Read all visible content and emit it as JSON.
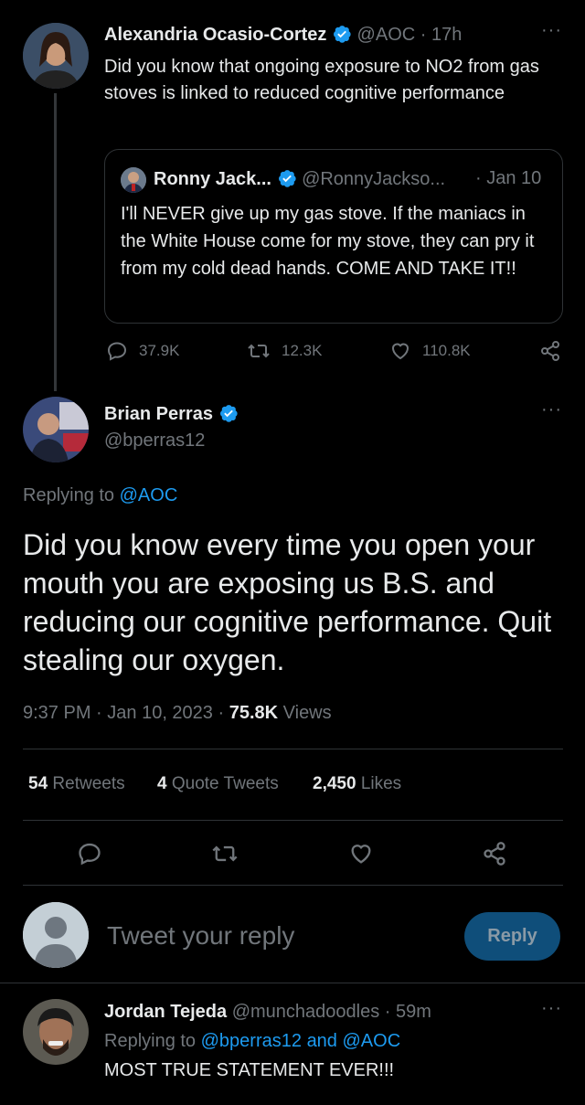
{
  "tweet1": {
    "name": "Alexandria Ocasio-Cortez",
    "handle": "@AOC",
    "time": "17h",
    "text": "Did you know that ongoing exposure to NO2 from gas stoves is linked to reduced cognitive performance",
    "quote": {
      "name": "Ronny Jack...",
      "handle": "@RonnyJackso...",
      "time": "Jan 10",
      "text": "I'll NEVER give up my gas stove. If the maniacs in the White House come for my stove, they can pry it from my cold dead hands. COME AND TAKE IT!!"
    },
    "replies": "37.9K",
    "retweets": "12.3K",
    "likes": "110.8K"
  },
  "tweet2": {
    "name": "Brian Perras",
    "handle": "@bperras12",
    "replying_label": "Replying to",
    "replying_to": "@AOC",
    "text": "Did you know every time you open your mouth you are exposing us B.S. and reducing our cognitive performance. Quit stealing our oxygen.",
    "time": "9:37 PM",
    "date": "Jan 10, 2023",
    "views": "75.8K",
    "views_label": "Views",
    "retweets": "54",
    "retweets_label": "Retweets",
    "quotes": "4",
    "quotes_label": "Quote Tweets",
    "likes": "2,450",
    "likes_label": "Likes"
  },
  "composer": {
    "placeholder": "Tweet your reply",
    "button": "Reply"
  },
  "tweet3": {
    "name": "Jordan Tejeda",
    "handle": "@munchadoodles",
    "time": "59m",
    "replying_label": "Replying to",
    "replying_to_1": "@bperras12",
    "and": "and",
    "replying_to_2": "@AOC",
    "text": "MOST TRUE STATEMENT EVER!!!"
  },
  "colors": {
    "accent": "#1d9bf0",
    "muted": "#71767b",
    "bg": "#000000"
  }
}
